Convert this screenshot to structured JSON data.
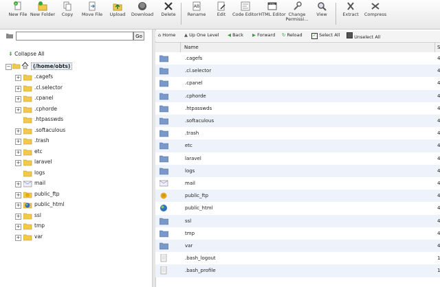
{
  "toolbar": {
    "buttons": [
      {
        "label": "New File",
        "icon": "new-file-icon"
      },
      {
        "label": "New Folder",
        "icon": "new-folder-icon"
      },
      {
        "label": "Copy",
        "icon": "copy-icon"
      },
      {
        "label": "Move File",
        "icon": "move-file-icon"
      },
      {
        "label": "Upload",
        "icon": "upload-icon"
      },
      {
        "label": "Download",
        "icon": "download-icon"
      },
      {
        "label": "Delete",
        "icon": "delete-icon"
      },
      {
        "label": "Rename",
        "icon": "rename-icon"
      },
      {
        "label": "Edit",
        "icon": "edit-icon"
      },
      {
        "label": "Code Editor",
        "icon": "code-editor-icon"
      },
      {
        "label": "HTML Editor",
        "icon": "html-editor-icon"
      },
      {
        "label": "Change Permissi...",
        "icon": "change-permissions-icon"
      },
      {
        "label": "View",
        "icon": "view-icon"
      },
      {
        "label": "Extract",
        "icon": "extract-icon"
      },
      {
        "label": "Compress",
        "icon": "compress-icon"
      }
    ]
  },
  "search": {
    "value": "",
    "go_label": "Go"
  },
  "tree": {
    "collapse_label": "Collapse All",
    "root_label": "(/home/obts)",
    "items": [
      {
        "label": ".cagefs",
        "expander": "+",
        "icon": "folder-icon"
      },
      {
        "label": ".cl.selector",
        "expander": "+",
        "icon": "folder-icon"
      },
      {
        "label": ".cpanel",
        "expander": "+",
        "icon": "folder-icon"
      },
      {
        "label": ".cphorde",
        "expander": "+",
        "icon": "folder-icon"
      },
      {
        "label": ".htpasswds",
        "expander": "",
        "icon": "folder-icon"
      },
      {
        "label": ".softaculous",
        "expander": "+",
        "icon": "folder-icon"
      },
      {
        "label": ".trash",
        "expander": "+",
        "icon": "folder-icon"
      },
      {
        "label": "etc",
        "expander": "+",
        "icon": "folder-icon"
      },
      {
        "label": "laravel",
        "expander": "+",
        "icon": "folder-icon"
      },
      {
        "label": "logs",
        "expander": "",
        "icon": "folder-icon"
      },
      {
        "label": "mail",
        "expander": "+",
        "icon": "mail-folder-icon"
      },
      {
        "label": "public_ftp",
        "expander": "+",
        "icon": "ftp-folder-icon"
      },
      {
        "label": "public_html",
        "expander": "+",
        "icon": "globe-folder-icon"
      },
      {
        "label": "ssl",
        "expander": "+",
        "icon": "folder-icon"
      },
      {
        "label": "tmp",
        "expander": "+",
        "icon": "folder-icon"
      },
      {
        "label": "var",
        "expander": "+",
        "icon": "folder-icon"
      }
    ]
  },
  "navbar": {
    "home": "Home",
    "up": "Up One Level",
    "back": "Back",
    "forward": "Forward",
    "reload": "Reload",
    "select_all": "Select All",
    "unselect_all": "Unselect All"
  },
  "table": {
    "header_name": "Name",
    "header_extra": "S",
    "rows": [
      {
        "name": ".cagefs",
        "icon": "folder-icon",
        "extra": "4"
      },
      {
        "name": ".cl.selector",
        "icon": "folder-icon",
        "extra": "4"
      },
      {
        "name": ".cpanel",
        "icon": "folder-icon",
        "extra": "4"
      },
      {
        "name": ".cphorde",
        "icon": "folder-icon",
        "extra": "4"
      },
      {
        "name": ".htpasswds",
        "icon": "folder-icon",
        "extra": "4"
      },
      {
        "name": ".softaculous",
        "icon": "folder-icon",
        "extra": "4"
      },
      {
        "name": ".trash",
        "icon": "folder-icon",
        "extra": "4"
      },
      {
        "name": "etc",
        "icon": "folder-icon",
        "extra": "4"
      },
      {
        "name": "laravel",
        "icon": "folder-icon",
        "extra": "4"
      },
      {
        "name": "logs",
        "icon": "folder-icon",
        "extra": "4"
      },
      {
        "name": "mail",
        "icon": "mail-folder-icon",
        "extra": "4"
      },
      {
        "name": "public_ftp",
        "icon": "ftp-folder-icon",
        "extra": "4"
      },
      {
        "name": "public_html",
        "icon": "globe-folder-icon",
        "extra": "4"
      },
      {
        "name": "ssl",
        "icon": "folder-icon",
        "extra": "4"
      },
      {
        "name": "tmp",
        "icon": "folder-icon",
        "extra": "4"
      },
      {
        "name": "var",
        "icon": "folder-icon",
        "extra": "4"
      },
      {
        "name": ".bash_logout",
        "icon": "file-icon",
        "extra": "1"
      },
      {
        "name": ".bash_profile",
        "icon": "file-icon",
        "extra": "1"
      }
    ]
  },
  "colors": {
    "folder": "#7a98c8",
    "tree_folder": "#f2c94c",
    "row_alt": "#eef2fa",
    "accent_green": "#3d9b3d"
  }
}
